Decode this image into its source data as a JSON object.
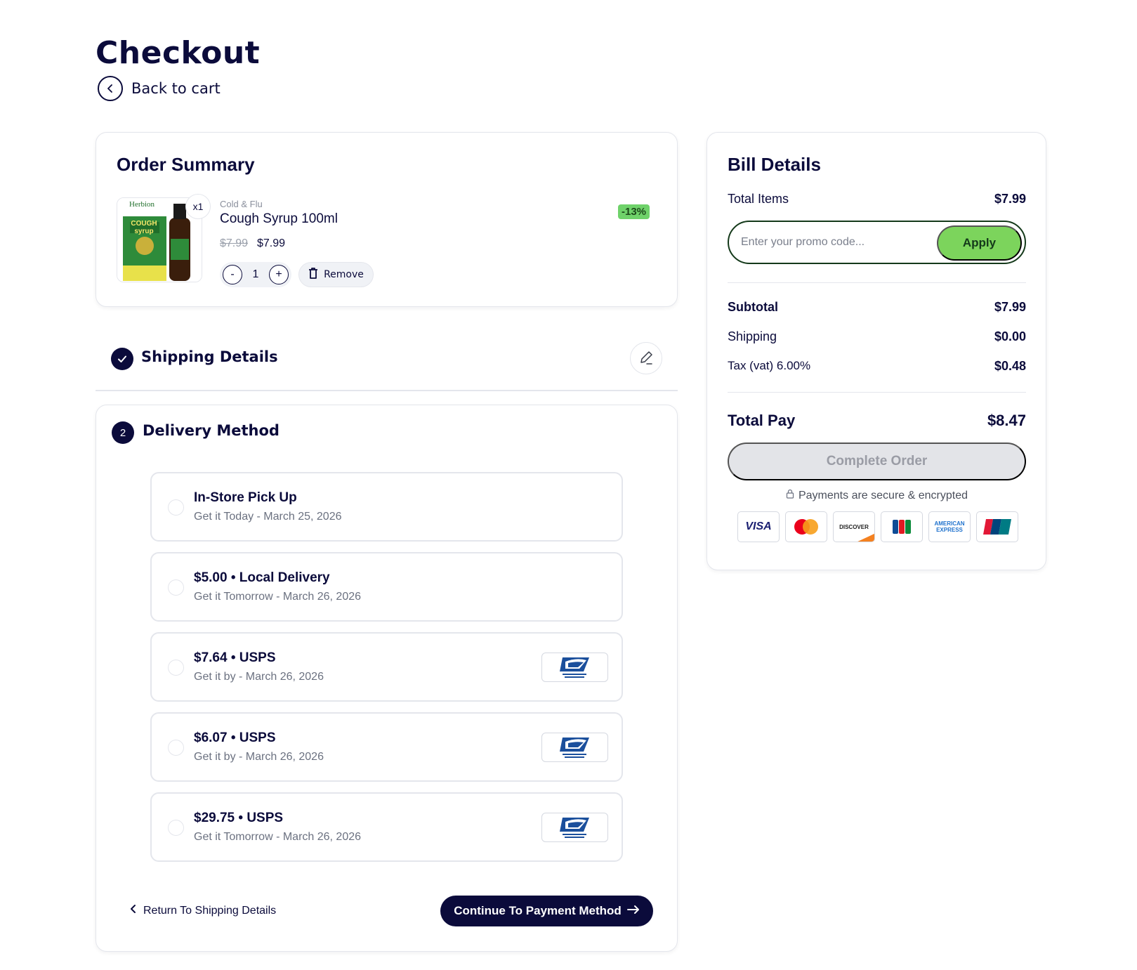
{
  "header": {
    "title": "Checkout",
    "back_label": "Back to cart"
  },
  "order_summary": {
    "title": "Order Summary",
    "item": {
      "qty_badge": "x1",
      "category": "Cold & Flu",
      "name": "Cough Syrup 100ml",
      "old_price": "$7.99",
      "price": "$7.99",
      "discount": "-13%",
      "quantity": "1",
      "minus": "-",
      "plus": "+",
      "remove_label": "Remove",
      "image_brand": "Herbion",
      "image_text": "COUGH syrup"
    }
  },
  "shipping": {
    "title": "Shipping Details",
    "completed": true
  },
  "delivery": {
    "step": "2",
    "title": "Delivery Method",
    "options": [
      {
        "title": "In-Store Pick Up",
        "subtitle": "Get it Today - March 25, 2026",
        "logo": ""
      },
      {
        "title": "$5.00 • Local Delivery",
        "subtitle": "Get it Tomorrow - March 26, 2026",
        "logo": ""
      },
      {
        "title": "$7.64 • USPS",
        "subtitle": "Get it by - March 26, 2026",
        "logo": "usps-logo"
      },
      {
        "title": "$6.07 • USPS",
        "subtitle": "Get it by - March 26, 2026",
        "logo": "usps-logo"
      },
      {
        "title": "$29.75 • USPS",
        "subtitle": "Get it Tomorrow - March 26, 2026",
        "logo": "usps-logo"
      }
    ],
    "return_label": "Return To Shipping Details",
    "continue_label": "Continue To Payment Method"
  },
  "bill": {
    "title": "Bill Details",
    "total_items_label": "Total Items",
    "total_items_value": "$7.99",
    "promo_placeholder": "Enter your promo code...",
    "apply_label": "Apply",
    "subtotal_label": "Subtotal",
    "subtotal_value": "$7.99",
    "shipping_label": "Shipping",
    "shipping_value": "$0.00",
    "tax_label": "Tax (vat) 6.00%",
    "tax_value": "$0.48",
    "total_label": "Total Pay",
    "total_value": "$8.47",
    "complete_label": "Complete Order",
    "secure_note": "Payments are secure & encrypted",
    "payment_cards": [
      "VISA",
      "MasterCard",
      "DISCOVER",
      "JCB",
      "AMERICAN EXPRESS",
      "UnionPay"
    ]
  },
  "colors": {
    "navy": "#0b0b3b",
    "green_accent": "#7cd45c",
    "discount_bg": "#6fd26a",
    "border": "#e4e6ec",
    "disabled_bg": "#e3e4e8"
  }
}
